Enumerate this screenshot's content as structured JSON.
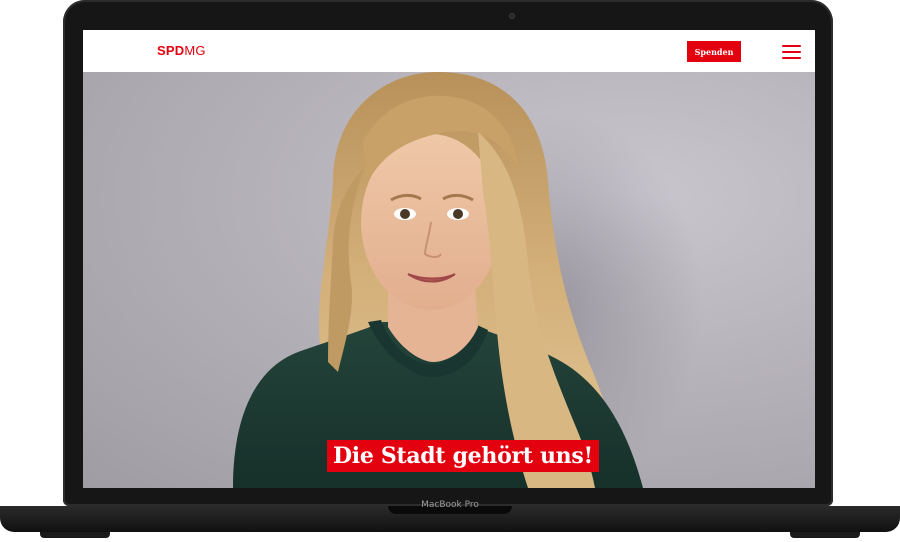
{
  "device": {
    "label": "MacBook Pro"
  },
  "site": {
    "logo_bold": "SPD",
    "logo_light": "MG",
    "donate_label": "Spenden",
    "menu_icon": "hamburger-menu-icon"
  },
  "hero": {
    "slogan": "Die Stadt gehört uns!"
  },
  "colors": {
    "brand_red": "#e3000f",
    "background_gray": "#b6b2b9",
    "shirt_green": "#1e3a32",
    "hair_blonde": "#c8a266"
  }
}
